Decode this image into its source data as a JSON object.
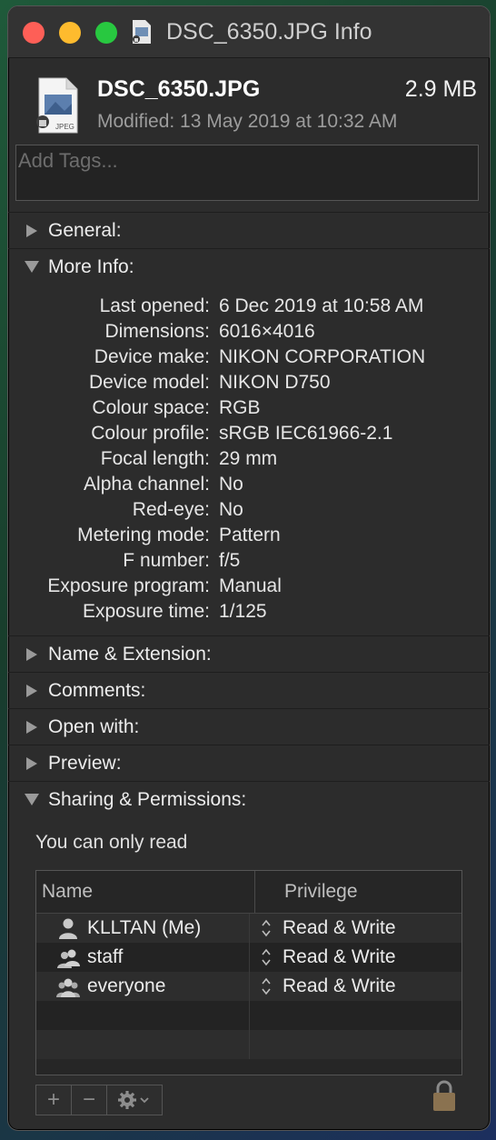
{
  "window": {
    "title": "DSC_6350.JPG Info"
  },
  "file": {
    "name": "DSC_6350.JPG",
    "size": "2.9 MB",
    "modified": "Modified: 13 May 2019 at 10:32 AM",
    "icon_label": "JPEG"
  },
  "tags": {
    "placeholder": "Add Tags..."
  },
  "sections": {
    "general": "General:",
    "more_info": "More Info:",
    "name_ext": "Name & Extension:",
    "comments": "Comments:",
    "open_with": "Open with:",
    "preview": "Preview:",
    "sharing": "Sharing & Permissions:"
  },
  "more_info": [
    {
      "key": "Last opened:",
      "value": "6 Dec 2019 at 10:58 AM"
    },
    {
      "key": "Dimensions:",
      "value": "6016×4016"
    },
    {
      "key": "Device make:",
      "value": "NIKON CORPORATION"
    },
    {
      "key": "Device model:",
      "value": "NIKON D750"
    },
    {
      "key": "Colour space:",
      "value": "RGB"
    },
    {
      "key": "Colour profile:",
      "value": "sRGB IEC61966-2.1"
    },
    {
      "key": "Focal length:",
      "value": "29 mm"
    },
    {
      "key": "Alpha channel:",
      "value": "No"
    },
    {
      "key": "Red-eye:",
      "value": "No"
    },
    {
      "key": "Metering mode:",
      "value": "Pattern"
    },
    {
      "key": "F number:",
      "value": "f/5"
    },
    {
      "key": "Exposure program:",
      "value": "Manual"
    },
    {
      "key": "Exposure time:",
      "value": "1/125"
    }
  ],
  "sharing": {
    "status": "You can only read",
    "columns": {
      "name": "Name",
      "privilege": "Privilege"
    },
    "rows": [
      {
        "name": "KLLTAN (Me)",
        "privilege": "Read & Write",
        "icon": "single-user-icon"
      },
      {
        "name": "staff",
        "privilege": "Read & Write",
        "icon": "group-icon"
      },
      {
        "name": "everyone",
        "privilege": "Read & Write",
        "icon": "everyone-icon"
      }
    ]
  },
  "toolbar": {
    "add": "+",
    "remove": "−"
  }
}
